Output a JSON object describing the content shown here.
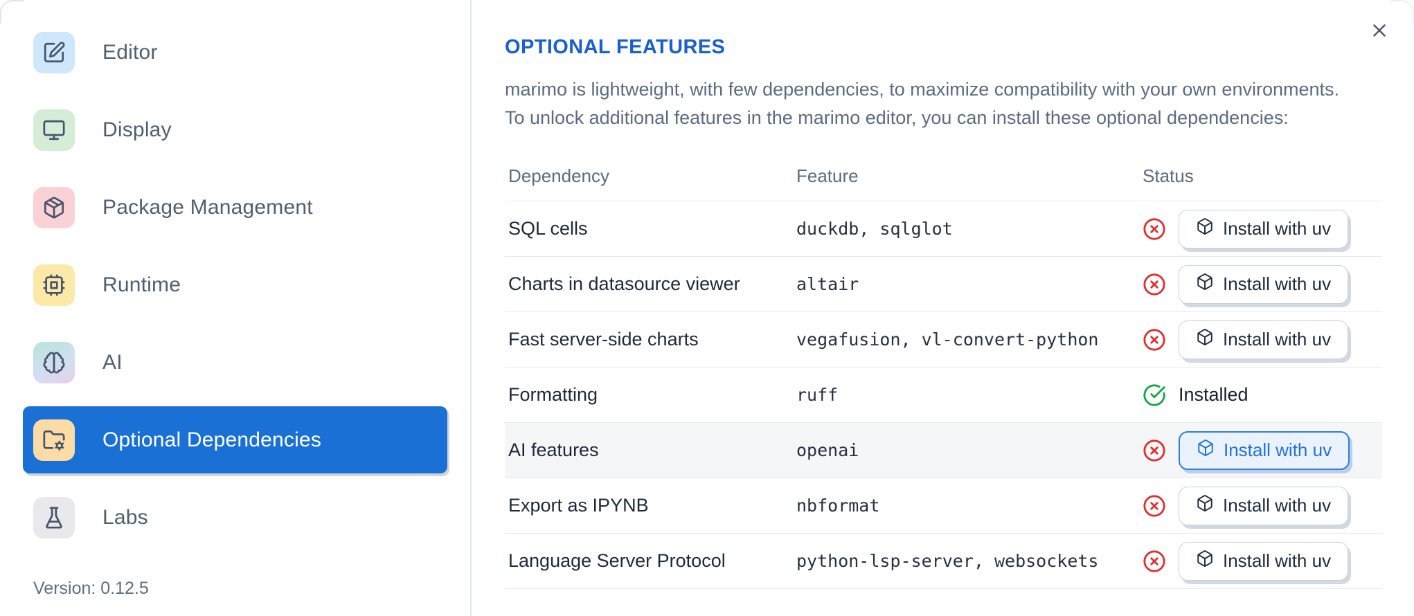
{
  "sidebar": {
    "items": [
      {
        "label": "Editor",
        "icon": "square-pen-icon",
        "tile_color": "#cfe7fa",
        "selected": false
      },
      {
        "label": "Display",
        "icon": "monitor-icon",
        "tile_color": "#d5edd6",
        "selected": false
      },
      {
        "label": "Package Management",
        "icon": "package-icon",
        "tile_color": "#fad2d5",
        "selected": false
      },
      {
        "label": "Runtime",
        "icon": "cpu-icon",
        "tile_color": "#fce9a7",
        "selected": false
      },
      {
        "label": "AI",
        "icon": "brain-icon",
        "tile_color": "linear-gradient teal/lavender",
        "selected": false
      },
      {
        "label": "Optional Dependencies",
        "icon": "folder-cog-icon",
        "tile_color": "#fcdca4",
        "selected": true
      },
      {
        "label": "Labs",
        "icon": "flask-icon",
        "tile_color": "#e8e8ed",
        "selected": false
      }
    ],
    "version_label": "Version: 0.12.5"
  },
  "dialog": {
    "title": "OPTIONAL FEATURES",
    "description_line1": "marimo is lightweight, with few dependencies, to maximize compatibility with your own environments.",
    "description_line2": "To unlock additional features in the marimo editor, you can install these optional dependencies:",
    "close_icon": "close-icon",
    "table": {
      "headers": [
        "Dependency",
        "Feature",
        "Status"
      ],
      "rows": [
        {
          "dependency": "SQL cells",
          "feature": "duckdb, sqlglot",
          "status": "not-installed",
          "action_label": "Install with uv"
        },
        {
          "dependency": "Charts in datasource viewer",
          "feature": "altair",
          "status": "not-installed",
          "action_label": "Install with uv"
        },
        {
          "dependency": "Fast server-side charts",
          "feature": "vegafusion, vl-convert-python",
          "status": "not-installed",
          "action_label": "Install with uv"
        },
        {
          "dependency": "Formatting",
          "feature": "ruff",
          "status": "installed",
          "status_label": "Installed"
        },
        {
          "dependency": "AI features",
          "feature": "openai",
          "status": "not-installed",
          "action_label": "Install with uv",
          "highlighted": true
        },
        {
          "dependency": "Export as IPYNB",
          "feature": "nbformat",
          "status": "not-installed",
          "action_label": "Install with uv"
        },
        {
          "dependency": "Language Server Protocol",
          "feature": "python-lsp-server, websockets",
          "status": "not-installed",
          "action_label": "Install with uv"
        }
      ]
    }
  },
  "colors": {
    "accent_blue": "#1b70d6",
    "title_blue": "#1a5ed0",
    "error_red": "#dc3032",
    "success_green": "#17a34a",
    "row_highlight": "#f4f6f8",
    "divider": "#e3e6eb"
  }
}
